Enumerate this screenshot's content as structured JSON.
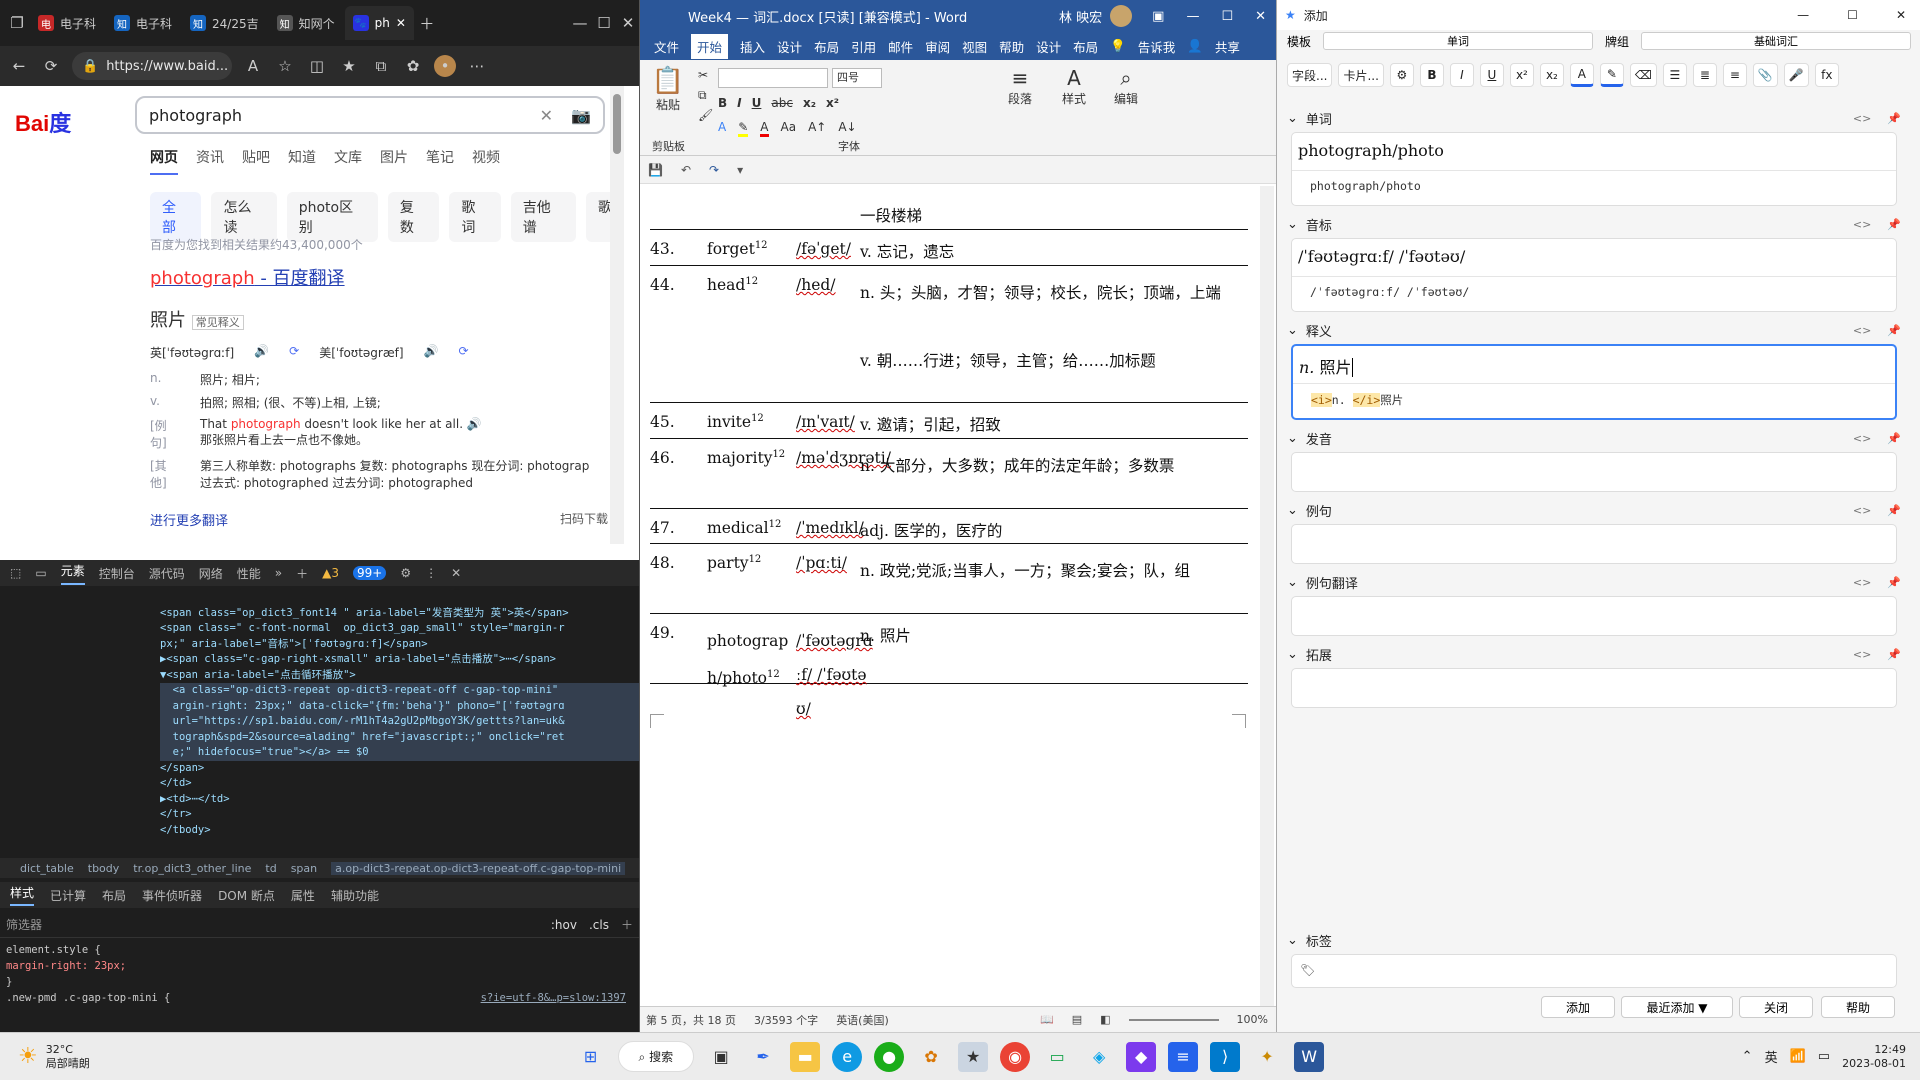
{
  "edge": {
    "tabs": [
      "电子科",
      "电子科",
      "24/25吉",
      "知网个",
      "ph"
    ],
    "url": "https://www.baid...",
    "search_value": "photograph",
    "logo": "Bai百度",
    "tabs_search": [
      "网页",
      "资讯",
      "贴吧",
      "知道",
      "文库",
      "图片",
      "笔记",
      "视频"
    ],
    "chips": [
      "全部",
      "怎么读",
      "photo区别",
      "复数",
      "歌词",
      "吉他谱",
      "歌"
    ],
    "result_count": "百度为您找到相关结果约43,400,000个",
    "result_title_a": "photograph",
    "result_title_b": " - 百度翻译",
    "card_title": "照片",
    "card_badge": "常见释义",
    "pron_uk": "英[ˈfəʊtəgrɑːf]",
    "pron_us": "美[ˈfoʊtəgræf]",
    "sense1_lab": "n.",
    "sense1": "照片; 相片;",
    "sense2_lab": "v.",
    "sense2": "拍照; 照相; (很、不等)上相, 上镜;",
    "ex_lab": "[例句]",
    "ex_a": "That ",
    "ex_b": "photograph",
    "ex_c": " doesn't look like her at all.",
    "ex_zh": "那张照片看上去一点也不像她。",
    "other_lab": "[其他]",
    "other1": "第三人称单数: photographs    复数: photographs    现在分词: photograp",
    "other2": "过去式: photographed    过去分词: photographed",
    "more": "进行更多翻译",
    "scan": "扫码下载"
  },
  "devtools": {
    "tabs": [
      "元素",
      "控制台",
      "源代码",
      "网络",
      "性能"
    ],
    "warn": "3",
    "info": "99+",
    "code": [
      "<span class=\"op_dict3_font14 \" aria-label=\"发音类型为 英\">英</span>",
      "<span class=\" c-font-normal  op_dict3_gap_small\" style=\"margin-r",
      "px;\" aria-label=\"音标\">[ˈfəʊtəgrɑːf]</span>",
      "▶<span class=\"c-gap-right-xsmall\" aria-label=\"点击播放\">⋯</span>",
      "▼<span aria-label=\"点击循环播放\">",
      "  <a class=\"op-dict3-repeat op-dict3-repeat-off c-gap-top-mini\"",
      "  argin-right: 23px;\" data-click=\"{fm:'beha'}\" phono=\"[ˈfəʊtəgrɑ",
      "  url=\"https://sp1.baidu.com/-rM1hT4a2gU2pMbgoY3K/gettts?lan=uk&",
      "  tograph&spd=2&source=alading\" href=\"javascript:;\" onclick=\"ret",
      "  e;\" hidefocus=\"true\"></a> == $0",
      "</span>",
      "</td>",
      "▶<td>⋯</td>",
      "</tr>",
      "</tbody>"
    ],
    "crumbs": [
      "dict_table",
      "tbody",
      "tr.op_dict3_other_line",
      "td",
      "span",
      "a.op-dict3-repeat.op-dict3-repeat-off.c-gap-top-mini"
    ],
    "tabs2": [
      "样式",
      "已计算",
      "布局",
      "事件侦听器",
      "DOM 断点",
      "属性",
      "辅助功能"
    ],
    "filter_ph": "筛选器",
    "hov": ":hov",
    "cls": ".cls",
    "style1": "element.style {",
    "style2": "  margin-right: 23px;",
    "style3": "}",
    "style4": ".new-pmd .c-gap-top-mini {",
    "style_src": "s?ie=utf-8&…p=slow:1397"
  },
  "word": {
    "title": "Week4 — 词汇.docx [只读] [兼容模式] - Word",
    "user": "林 映宏",
    "menu": [
      "文件",
      "开始",
      "插入",
      "设计",
      "布局",
      "引用",
      "邮件",
      "审阅",
      "视图",
      "帮助",
      "设计",
      "布局"
    ],
    "tell": "告诉我",
    "share": "共享",
    "font_size": "四号",
    "groups": [
      "剪贴板",
      "字体",
      "段落",
      "样式",
      "编辑"
    ],
    "paste": "粘贴",
    "prev_line": "一段楼梯",
    "entries": [
      {
        "num": "43.",
        "word": "forget",
        "sup": "12",
        "pron": "/fəˈget/",
        "def": "v. 忘记，遗忘"
      },
      {
        "num": "44.",
        "word": "head",
        "sup": "12",
        "pron": "/hed/",
        "def": "n. 头；头脑，才智；领导；校长，院长；顶端，上端",
        "def2": "v. 朝……行进；领导，主管；给……加标题"
      },
      {
        "num": "45.",
        "word": "invite",
        "sup": "12",
        "pron": "/ɪnˈvaɪt/",
        "def": "v. 邀请；引起，招致"
      },
      {
        "num": "46.",
        "word": "majority",
        "sup": "12",
        "pron": "/məˈdʒɒrəti/",
        "def": "n. 大部分，大多数；成年的法定年龄；多数票"
      },
      {
        "num": "47.",
        "word": "medical",
        "sup": "12",
        "pron": "/ˈmedɪkl/",
        "def": "adj. 医学的，医疗的"
      },
      {
        "num": "48.",
        "word": "party",
        "sup": "12",
        "pron": "/ˈpɑːti/",
        "def": "n. 政党;党派;当事人，一方；聚会;宴会；队，组"
      },
      {
        "num": "49.",
        "word": "photograph/photo",
        "sup": "12",
        "pron": "/ˈfəʊtəgrɑːf/ /ˈfəʊtəʊ/",
        "def": "n. 照片"
      }
    ],
    "status": [
      "第 5 页，共 18 页",
      "3/3593 个字",
      "英语(美国)"
    ],
    "zoom": "100%"
  },
  "anki": {
    "title": "添加",
    "type_label": "模板",
    "type_value": "单词",
    "deck_label": "牌组",
    "deck_value": "基础词汇",
    "fields_btn": "字段...",
    "cards_btn": "卡片...",
    "fields": [
      {
        "name": "单词",
        "value": "photograph/photo",
        "html": "photograph/photo"
      },
      {
        "name": "音标",
        "value": "/ˈfəʊtəgrɑːf/ /ˈfəʊtəʊ/",
        "html": "/ˈfəʊtəgrɑːf/  /ˈfəʊtəʊ/"
      },
      {
        "name": "释义",
        "value_i": "n.",
        "value": " 照片",
        "html_a": "<i>",
        "html_b": "n. ",
        "html_c": "</i>",
        "html_d": "照片"
      },
      {
        "name": "发音"
      },
      {
        "name": "例句"
      },
      {
        "name": "例句翻译"
      },
      {
        "name": "拓展"
      },
      {
        "name": "标签"
      }
    ],
    "buttons": [
      "添加",
      "最近添加 ▼",
      "关闭",
      "帮助"
    ]
  },
  "taskbar": {
    "temp": "32°C",
    "weather": "局部晴朗",
    "search": "搜索",
    "ime": "英",
    "time": "12:49",
    "date": "2023-08-01"
  }
}
